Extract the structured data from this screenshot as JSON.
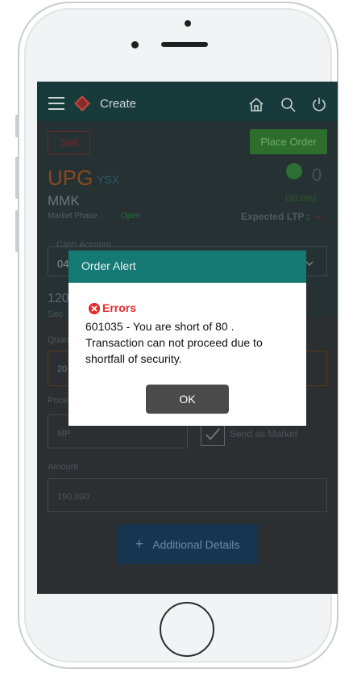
{
  "header": {
    "title": "Create"
  },
  "order": {
    "sell_label": "Sell",
    "place_order_label": "Place Order",
    "symbol": "UPG",
    "exchange": "YSX",
    "currency": "MMK",
    "market_phase_label": "Market Phase :",
    "market_phase_value": "Open",
    "ltp": "0",
    "change": "0(0.0%)",
    "expected_ltp_label": "Expected LTP :",
    "expected_ltp_value": "--",
    "cash_account_label": "Cash Account",
    "cash_account_value": "04",
    "holding_value": "120",
    "holding_label": "Sec",
    "quantity_label": "Quan",
    "quantity_value": "20",
    "price_label": "Price",
    "price_value": "MP",
    "send_as_market_label": "Send as Market",
    "amount_label": "Amount",
    "amount_value": "190,000",
    "additional_details_label": "Additional Details",
    "additional_details_icon": "+"
  },
  "modal": {
    "title": "Order Alert",
    "error_heading": "Errors",
    "error_message": "601035 - You are short of 80 . Transaction can not proceed due to shortfall of security.",
    "ok_label": "OK"
  },
  "colors": {
    "topbar": "#173b3b",
    "modal_header": "#157a74",
    "error": "#e02b2b",
    "ok_button": "#4a4a4a"
  },
  "icons": [
    "menu-icon",
    "logo-icon",
    "home-icon",
    "search-icon",
    "power-icon",
    "trend-icon",
    "chevron-down-icon",
    "error-icon",
    "check-icon",
    "plus-icon"
  ]
}
